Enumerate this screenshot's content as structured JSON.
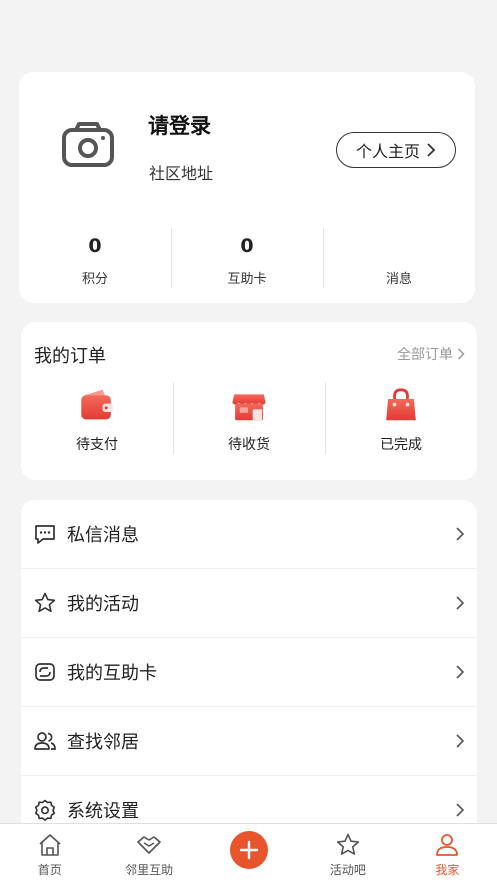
{
  "profile": {
    "username": "请登录",
    "address": "社区地址",
    "homepage_button": "个人主页",
    "stats": [
      {
        "value": "0",
        "label": "积分"
      },
      {
        "value": "0",
        "label": "互助卡"
      },
      {
        "value": "",
        "label": "消息"
      }
    ]
  },
  "orders": {
    "title": "我的订单",
    "all_link": "全部订单",
    "items": [
      {
        "label": "待支付",
        "icon": "wallet-icon"
      },
      {
        "label": "待收货",
        "icon": "shop-icon"
      },
      {
        "label": "已完成",
        "icon": "bag-icon"
      }
    ]
  },
  "menu": {
    "items": [
      {
        "label": "私信消息",
        "icon": "message-icon"
      },
      {
        "label": "我的活动",
        "icon": "star-icon"
      },
      {
        "label": "我的互助卡",
        "icon": "card-icon"
      },
      {
        "label": "查找邻居",
        "icon": "people-icon"
      },
      {
        "label": "系统设置",
        "icon": "settings-icon"
      }
    ]
  },
  "tabbar": {
    "items": [
      {
        "label": "首页",
        "icon": "home-icon"
      },
      {
        "label": "邻里互助",
        "icon": "handshake-icon"
      },
      {
        "label": "",
        "icon": "plus-icon"
      },
      {
        "label": "活动吧",
        "icon": "star-icon"
      },
      {
        "label": "我家",
        "icon": "user-icon",
        "active": true
      }
    ]
  },
  "colors": {
    "accent": "#e8552d",
    "icon_red": "#e9473f",
    "background": "#f3f3f3"
  }
}
